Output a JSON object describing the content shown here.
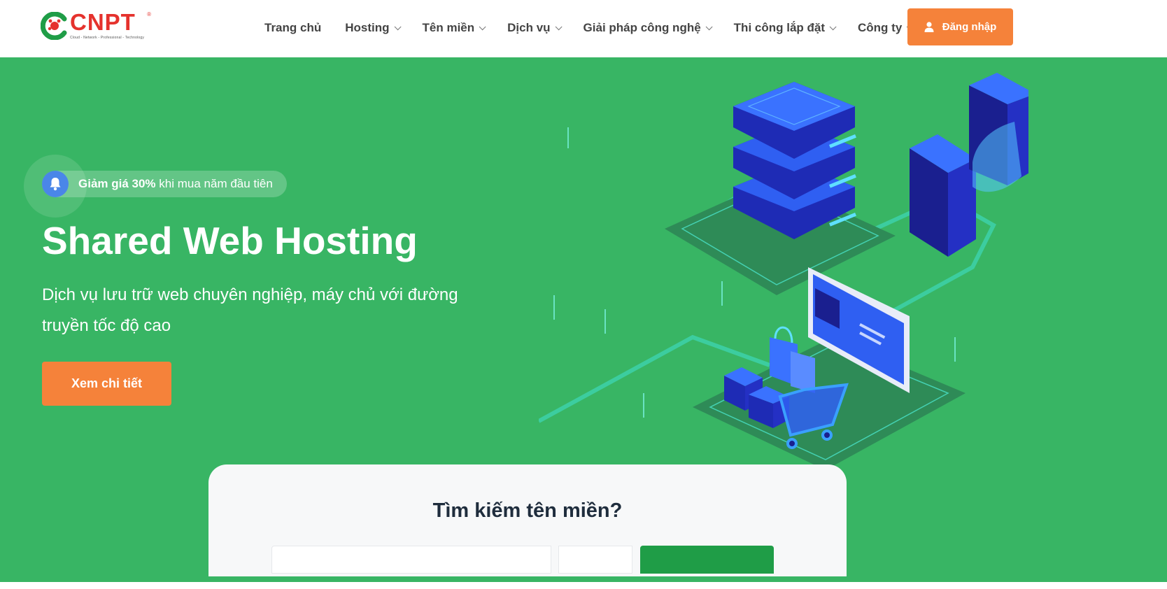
{
  "brand": {
    "name": "CNPT",
    "registered": "®",
    "tagline": "Cloud - Network - Professional - Technology",
    "colors": {
      "primary_red": "#e5322d",
      "green": "#38b564",
      "accent": "#f5823a",
      "icon_blue": "#4a86e8"
    }
  },
  "nav": {
    "items": [
      {
        "label": "Trang chủ",
        "has_dropdown": false
      },
      {
        "label": "Hosting",
        "has_dropdown": true
      },
      {
        "label": "Tên miền",
        "has_dropdown": true
      },
      {
        "label": "Dịch vụ",
        "has_dropdown": true
      },
      {
        "label": "Giải pháp công nghệ",
        "has_dropdown": true
      },
      {
        "label": "Thi công lắp đặt",
        "has_dropdown": true
      },
      {
        "label": "Công ty",
        "has_dropdown": true
      }
    ],
    "login_label": "Đăng nhập",
    "login_icon": "user-icon"
  },
  "hero": {
    "promo_bold": "Giảm giá 30%",
    "promo_rest": " khi mua năm đầu tiên",
    "promo_icon": "bell-icon",
    "title": "Shared Web Hosting",
    "subtitle": "Dịch vụ lưu trữ web chuyên nghiệp, máy chủ với đường truyền tốc độ cao",
    "cta_label": "Xem chi tiết"
  },
  "domain_search": {
    "title": "Tìm kiếm tên miền?"
  }
}
